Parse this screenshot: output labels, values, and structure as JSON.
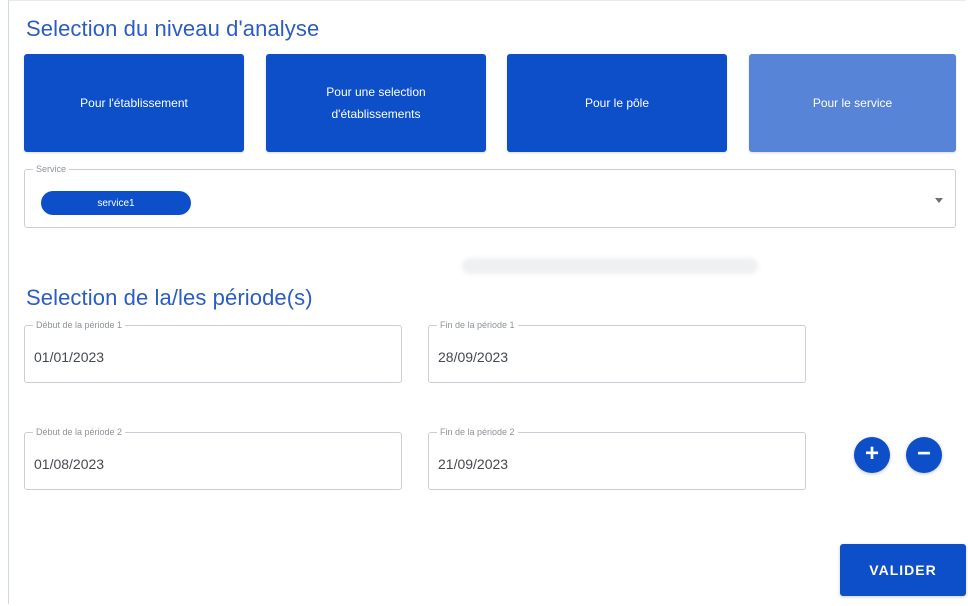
{
  "analysis_level": {
    "title": "Selection du niveau d'analyse",
    "options": [
      {
        "label": "Pour l'établissement",
        "selected": false
      },
      {
        "label": "Pour une selection d'établissements",
        "selected": false
      },
      {
        "label": "Pour le pôle",
        "selected": false
      },
      {
        "label": "Pour le service",
        "selected": true
      }
    ]
  },
  "service": {
    "label": "Service",
    "chips": [
      "service1"
    ],
    "dropdown_icon": "caret-down-icon"
  },
  "periods": {
    "title": "Selection de la/les période(s)",
    "rows": [
      {
        "start_label": "Début de la période 1",
        "start_value": "01/01/2023",
        "end_label": "Fin de la période 1",
        "end_value": "28/09/2023"
      },
      {
        "start_label": "Début de la période 2",
        "start_value": "01/08/2023",
        "end_label": "Fin de la période 2",
        "end_value": "21/09/2023"
      }
    ],
    "add_icon": "plus-icon",
    "remove_icon": "minus-icon"
  },
  "actions": {
    "submit_label": "VALIDER"
  },
  "colors": {
    "primary": "#0c4fc9",
    "selected_option": "#5784d6",
    "title": "#2b5cc5"
  }
}
